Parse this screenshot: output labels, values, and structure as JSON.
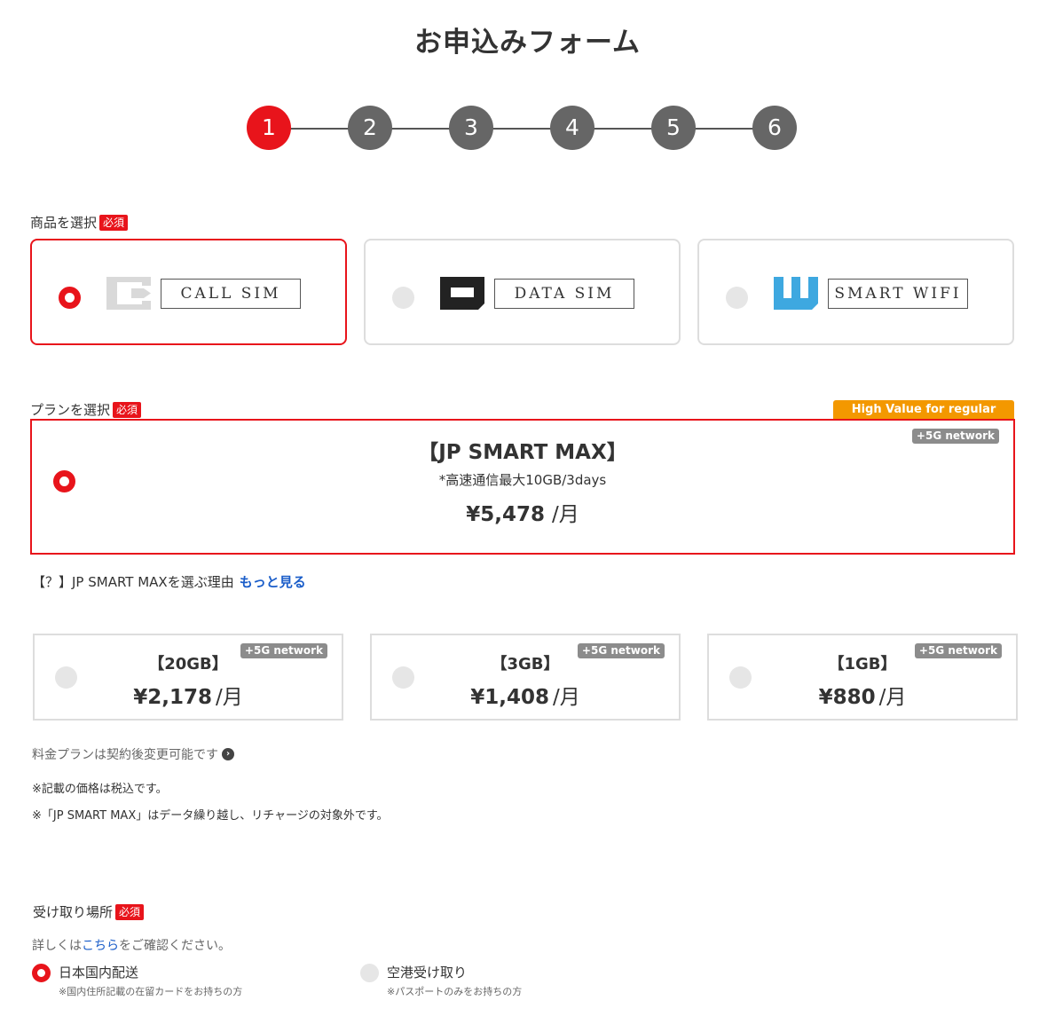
{
  "page": {
    "title": "お申込みフォーム"
  },
  "steps": [
    "1",
    "2",
    "3",
    "4",
    "5",
    "6"
  ],
  "product_section": {
    "label": "商品を選択",
    "required": "必須",
    "products": [
      {
        "name": "CALL SIM",
        "icon": "call-sim-logo-icon",
        "selected": true
      },
      {
        "name": "DATA SIM",
        "icon": "data-sim-logo-icon",
        "selected": false
      },
      {
        "name": "SMART WIFI",
        "icon": "smart-wifi-logo-icon",
        "selected": false
      }
    ]
  },
  "plan_section": {
    "label": "プランを選択",
    "required": "必須",
    "featured_badge": "High Value for regular users",
    "featured": {
      "name": "【JP SMART MAX】",
      "network_badge": "+5G network",
      "note": "*高速通信最大10GB/3days",
      "price": "¥5,478",
      "unit": "/月"
    },
    "why_text": "【？】JP SMART MAXを選ぶ理由",
    "more_link": "もっと見る",
    "plans": [
      {
        "name": "【20GB】",
        "network_badge": "+5G network",
        "price": "¥2,178",
        "unit": "/月"
      },
      {
        "name": "【3GB】",
        "network_badge": "+5G network",
        "price": "¥1,408",
        "unit": "/月"
      },
      {
        "name": "【1GB】",
        "network_badge": "+5G network",
        "price": "¥880",
        "unit": "/月"
      }
    ],
    "change_note": "料金プランは契約後変更可能です",
    "note1": "※記載の価格は税込です。",
    "note2": "※「JP SMART MAX」はデータ繰り越し、リチャージの対象外です。"
  },
  "receipt_section": {
    "label": "受け取り場所",
    "required": "必須",
    "desc_prefix": "詳しくは",
    "desc_link": "こちら",
    "desc_suffix": "をご確認ください。",
    "options": [
      {
        "label": "日本国内配送",
        "sub": "※国内住所記載の在留カードをお持ちの方",
        "selected": true
      },
      {
        "label": "空港受け取り",
        "sub": "※パスポートのみをお持ちの方",
        "selected": false
      }
    ]
  },
  "colors": {
    "accent": "#e8141b",
    "step_inactive": "#666666",
    "badge_orange": "#f39800",
    "link": "#1a5dc9",
    "wifi_blue": "#3ea8e0"
  }
}
